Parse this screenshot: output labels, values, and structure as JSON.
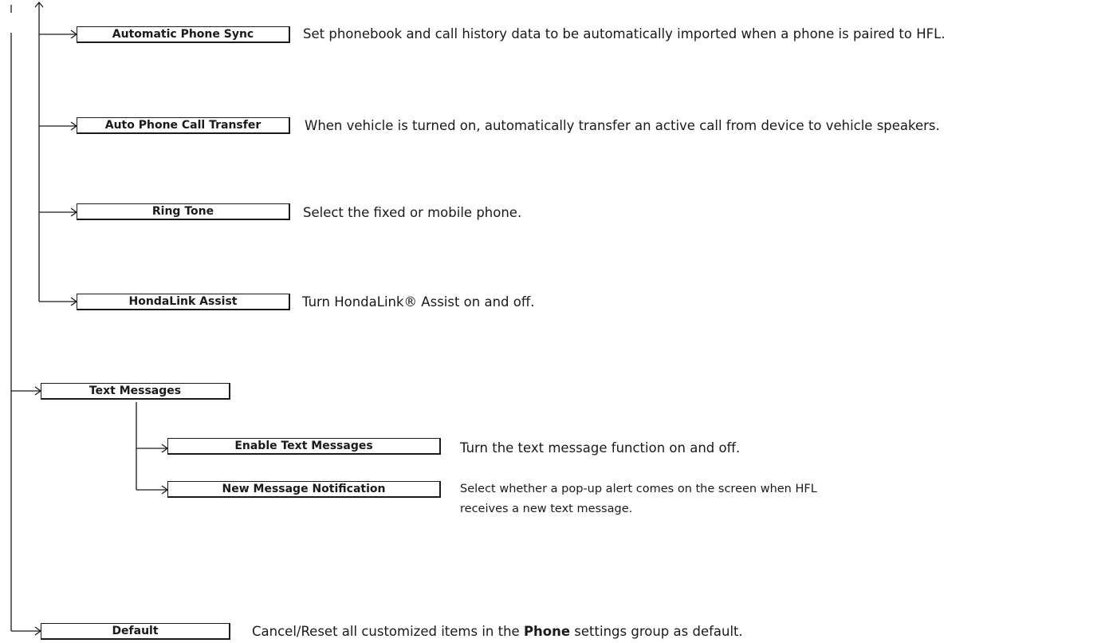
{
  "items": {
    "automatic_phone_sync": {
      "label": "Automatic Phone Sync",
      "description": "Set phonebook and call history data to be automatically imported when a phone is paired to HFL."
    },
    "auto_phone_call_transfer": {
      "label": "Auto Phone Call Transfer",
      "description": "When vehicle is turned on, automatically transfer an active call from device to vehicle speakers."
    },
    "ring_tone": {
      "label": "Ring Tone",
      "description": "Select the fixed or mobile phone."
    },
    "hondalink_assist": {
      "label": "HondaLink Assist",
      "description": "Turn HondaLink® Assist on and off."
    },
    "text_messages": {
      "label": "Text Messages"
    },
    "enable_text_messages": {
      "label": "Enable Text Messages",
      "description": "Turn the text message function on and off."
    },
    "new_message_notification": {
      "label": "New Message Notification",
      "description_line1": "Select whether a pop-up alert comes on the screen when HFL",
      "description_line2": "receives a new text message."
    },
    "default": {
      "label": "Default",
      "description_before": "Cancel/Reset all customized items in the ",
      "description_bold": "Phone",
      "description_after": " settings group as default."
    }
  },
  "colors": {
    "line": "#1a1a1a",
    "background": "#ffffff",
    "text": "#1a1a1a"
  }
}
